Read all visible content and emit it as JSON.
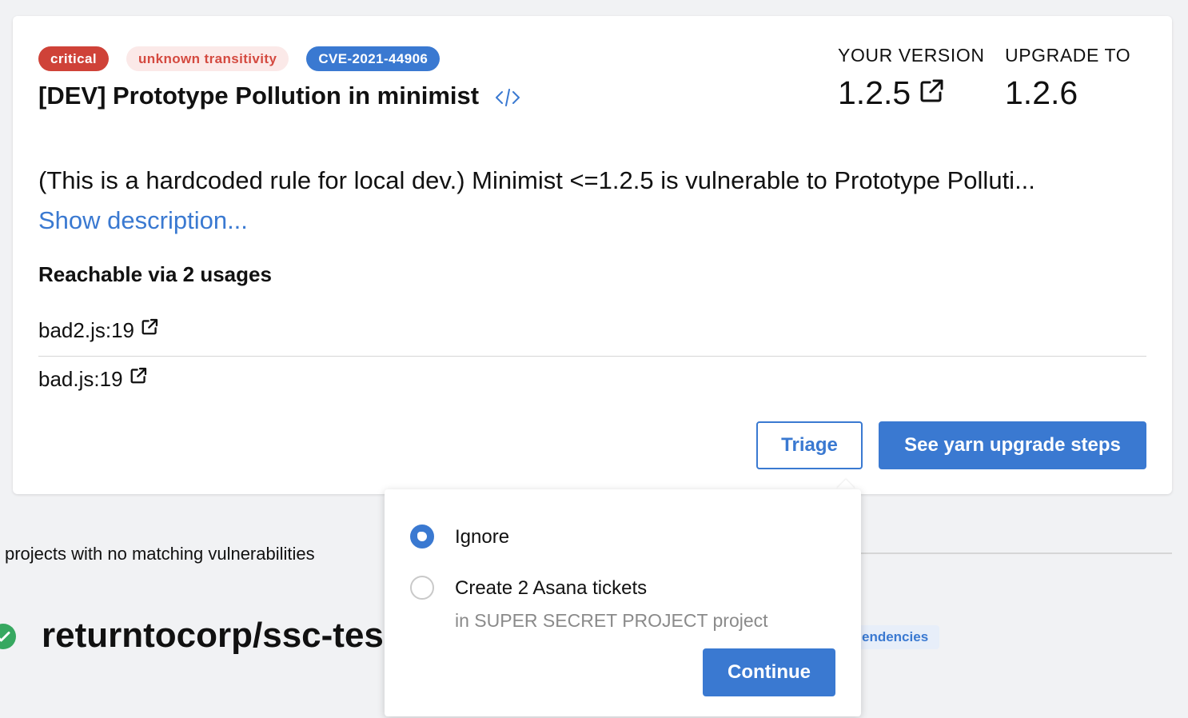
{
  "card": {
    "badges": {
      "severity": "critical",
      "transitivity": "unknown transitivity",
      "cve": "CVE-2021-44906"
    },
    "title": "[DEV] Prototype Pollution in minimist",
    "your_version_label": "YOUR VERSION",
    "your_version_value": "1.2.5",
    "upgrade_to_label": "UPGRADE TO",
    "upgrade_to_value": "1.2.6",
    "description": "(This is a hardcoded rule for local dev.) Minimist <=1.2.5 is vulnerable to Prototype Polluti...",
    "show_description": "Show description...",
    "reachable_heading": "Reachable via 2 usages",
    "usages": [
      "bad2.js:19",
      "bad.js:19"
    ],
    "triage_button": "Triage",
    "upgrade_button": "See yarn upgrade steps"
  },
  "background": {
    "projects_note": "projects with no matching vulnerabilities",
    "repo_name": "returntocorp/ssc-tes",
    "dependencies_badge": "endencies"
  },
  "triage_popover": {
    "options": [
      {
        "label": "Ignore",
        "selected": true
      },
      {
        "label": "Create 2 Asana tickets",
        "sublabel": "in SUPER SECRET PROJECT project",
        "selected": false
      }
    ],
    "continue_button": "Continue"
  },
  "colors": {
    "accent": "#3a79d1",
    "critical": "#cf4238",
    "critical_soft": "#fbe9e8",
    "success": "#37a860"
  },
  "icons": {
    "source_code": "code-icon",
    "external_link": "external-link-icon",
    "status_ok": "check-circle-icon"
  }
}
